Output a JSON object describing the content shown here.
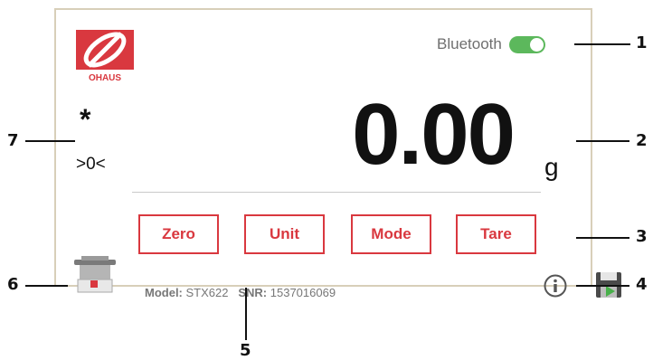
{
  "brand": {
    "logo_text": "OHAUS",
    "accent_color": "#d9383f"
  },
  "header": {
    "bluetooth_label": "Bluetooth",
    "bluetooth_enabled": true,
    "toggle_color": "#5cb85c"
  },
  "status": {
    "stability_indicator": "*",
    "zero_indicator": ">0<"
  },
  "display": {
    "weight": "0.00",
    "unit": "g"
  },
  "keys": {
    "zero": "Zero",
    "unit": "Unit",
    "mode": "Mode",
    "tare": "Tare"
  },
  "footer": {
    "model_label": "Model:",
    "model_value": "STX622",
    "snr_label": "SNR:",
    "snr_value": "1537016069"
  },
  "icons": {
    "info": "info-icon",
    "save": "save-icon",
    "balance": "balance-icon",
    "bluetooth_toggle": "toggle-switch"
  },
  "callouts": [
    "1",
    "2",
    "3",
    "4",
    "5",
    "6",
    "7"
  ]
}
